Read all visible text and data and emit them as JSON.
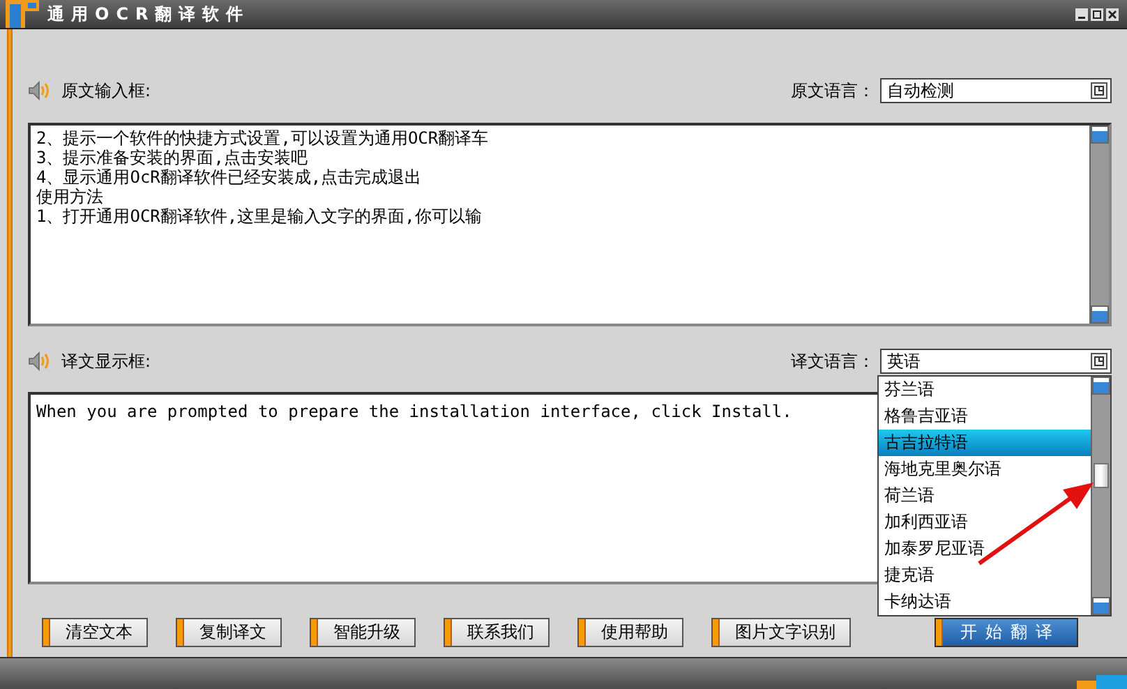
{
  "window": {
    "title": "通用OCR翻译软件"
  },
  "source": {
    "label": "原文输入框:",
    "language_label": "原文语言：",
    "language": "自动检测",
    "lines": [
      "2、提示一个软件的快捷方式设置,可以设置为通用OCR翻译车",
      "3、提示准备安装的界面,点击安装吧",
      "4、显示通用OcR翻译软件已经安装成,点击完成退出",
      "使用方法",
      "1、打开通用OCR翻译软件,这里是输入文字的界面,你可以输"
    ]
  },
  "target": {
    "label": "译文显示框:",
    "language_label": "译文语言：",
    "language": "英语",
    "text": "When you are prompted to prepare the installation interface, click Install.",
    "dropdown": {
      "options": [
        {
          "label": "芬兰语",
          "selected": false
        },
        {
          "label": "格鲁吉亚语",
          "selected": false
        },
        {
          "label": "古吉拉特语",
          "selected": true
        },
        {
          "label": "海地克里奥尔语",
          "selected": false
        },
        {
          "label": "荷兰语",
          "selected": false
        },
        {
          "label": "加利西亚语",
          "selected": false
        },
        {
          "label": "加泰罗尼亚语",
          "selected": false
        },
        {
          "label": "捷克语",
          "selected": false
        },
        {
          "label": "卡纳达语",
          "selected": false
        }
      ]
    }
  },
  "buttons": [
    {
      "label": "清空文本",
      "kind": "tool"
    },
    {
      "label": "复制译文",
      "kind": "tool"
    },
    {
      "label": "智能升级",
      "kind": "tool"
    },
    {
      "label": "联系我们",
      "kind": "tool"
    },
    {
      "label": "使用帮助",
      "kind": "tool"
    },
    {
      "label": "图片文字识别",
      "kind": "tool"
    },
    {
      "label": "开始翻译",
      "kind": "primary"
    }
  ]
}
